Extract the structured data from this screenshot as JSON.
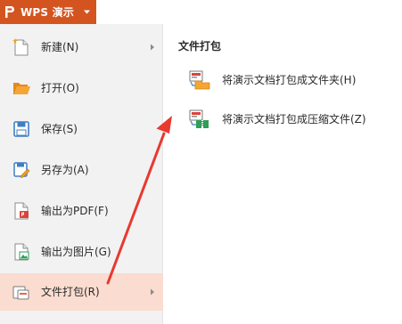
{
  "app_button": {
    "title": "WPS 演示",
    "logo": "wps-presentation-logo",
    "caret": "caret-down-icon",
    "background": "#d4541f"
  },
  "menu": {
    "items": [
      {
        "label": "新建(N)",
        "icon": "new-file-icon",
        "has_submenu": true
      },
      {
        "label": "打开(O)",
        "icon": "open-folder-icon",
        "has_submenu": false
      },
      {
        "label": "保存(S)",
        "icon": "save-icon",
        "has_submenu": false
      },
      {
        "label": "另存为(A)",
        "icon": "save-as-icon",
        "has_submenu": false
      },
      {
        "label": "输出为PDF(F)",
        "icon": "export-pdf-icon",
        "has_submenu": false
      },
      {
        "label": "输出为图片(G)",
        "icon": "export-image-icon",
        "has_submenu": false
      },
      {
        "label": "文件打包(R)",
        "icon": "package-file-icon",
        "has_submenu": true,
        "active": true
      }
    ],
    "active_background": "#fbdcd0"
  },
  "submenu": {
    "heading": "文件打包",
    "items": [
      {
        "label": "将演示文档打包成文件夹(H)",
        "icon": "package-to-folder-icon"
      },
      {
        "label": "将演示文档打包成压缩文件(Z)",
        "icon": "package-to-zip-icon"
      }
    ]
  },
  "annotation": {
    "shape": "red-arrow-icon",
    "color": "#e8392f"
  }
}
